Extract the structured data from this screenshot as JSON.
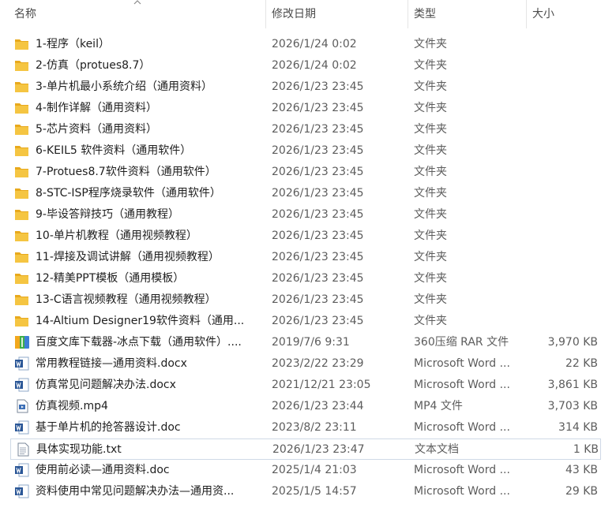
{
  "columns": {
    "name": "名称",
    "date": "修改日期",
    "type": "类型",
    "size": "大小"
  },
  "icons": {
    "folder": "folder-icon",
    "rar": "rar-archive-icon",
    "word": "word-document-icon",
    "video": "video-file-icon",
    "text": "text-file-icon"
  },
  "colors": {
    "folder": "#f5c542",
    "word": "#2b5797",
    "selected_border": "#cfd9e6"
  },
  "files": [
    {
      "name": "1-程序（keil）",
      "date": "2026/1/24 0:02",
      "type": "文件夹",
      "size": "",
      "icon": "folder"
    },
    {
      "name": "2-仿真（protues8.7）",
      "date": "2026/1/24 0:02",
      "type": "文件夹",
      "size": "",
      "icon": "folder"
    },
    {
      "name": "3-单片机最小系统介绍（通用资料）",
      "date": "2026/1/23 23:45",
      "type": "文件夹",
      "size": "",
      "icon": "folder"
    },
    {
      "name": "4-制作详解（通用资料）",
      "date": "2026/1/23 23:45",
      "type": "文件夹",
      "size": "",
      "icon": "folder"
    },
    {
      "name": "5-芯片资料（通用资料）",
      "date": "2026/1/23 23:45",
      "type": "文件夹",
      "size": "",
      "icon": "folder"
    },
    {
      "name": "6-KEIL5 软件资料（通用软件）",
      "date": "2026/1/23 23:45",
      "type": "文件夹",
      "size": "",
      "icon": "folder"
    },
    {
      "name": "7-Protues8.7软件资料（通用软件）",
      "date": "2026/1/23 23:45",
      "type": "文件夹",
      "size": "",
      "icon": "folder"
    },
    {
      "name": "8-STC-ISP程序烧录软件（通用软件）",
      "date": "2026/1/23 23:45",
      "type": "文件夹",
      "size": "",
      "icon": "folder"
    },
    {
      "name": "9-毕设答辩技巧（通用教程）",
      "date": "2026/1/23 23:45",
      "type": "文件夹",
      "size": "",
      "icon": "folder"
    },
    {
      "name": "10-单片机教程（通用视频教程）",
      "date": "2026/1/23 23:45",
      "type": "文件夹",
      "size": "",
      "icon": "folder"
    },
    {
      "name": "11-焊接及调试讲解（通用视频教程）",
      "date": "2026/1/23 23:45",
      "type": "文件夹",
      "size": "",
      "icon": "folder"
    },
    {
      "name": "12-精美PPT模板（通用模板）",
      "date": "2026/1/23 23:45",
      "type": "文件夹",
      "size": "",
      "icon": "folder"
    },
    {
      "name": "13-C语言视频教程（通用视频教程）",
      "date": "2026/1/23 23:45",
      "type": "文件夹",
      "size": "",
      "icon": "folder"
    },
    {
      "name": "14-Altium Designer19软件资料（通用...",
      "date": "2026/1/23 23:45",
      "type": "文件夹",
      "size": "",
      "icon": "folder"
    },
    {
      "name": "百度文库下载器-冰点下载（通用软件）....",
      "date": "2019/7/6 9:31",
      "type": "360压缩 RAR 文件",
      "size": "3,970 KB",
      "icon": "rar"
    },
    {
      "name": "常用教程链接—通用资料.docx",
      "date": "2023/2/22 23:29",
      "type": "Microsoft Word ...",
      "size": "22 KB",
      "icon": "word"
    },
    {
      "name": "仿真常见问题解决办法.docx",
      "date": "2021/12/21 23:05",
      "type": "Microsoft Word ...",
      "size": "3,861 KB",
      "icon": "word"
    },
    {
      "name": "仿真视频.mp4",
      "date": "2026/1/23 23:44",
      "type": "MP4 文件",
      "size": "3,703 KB",
      "icon": "video"
    },
    {
      "name": "基于单片机的抢答器设计.doc",
      "date": "2023/8/2 23:11",
      "type": "Microsoft Word ...",
      "size": "314 KB",
      "icon": "word"
    },
    {
      "name": "具体实现功能.txt",
      "date": "2026/1/23 23:47",
      "type": "文本文档",
      "size": "1 KB",
      "icon": "text",
      "selected": true
    },
    {
      "name": "使用前必读—通用资料.doc",
      "date": "2025/1/4 21:03",
      "type": "Microsoft Word ...",
      "size": "43 KB",
      "icon": "word"
    },
    {
      "name": "资料使用中常见问题解决办法—通用资...",
      "date": "2025/1/5 14:57",
      "type": "Microsoft Word ...",
      "size": "29 KB",
      "icon": "word"
    }
  ]
}
